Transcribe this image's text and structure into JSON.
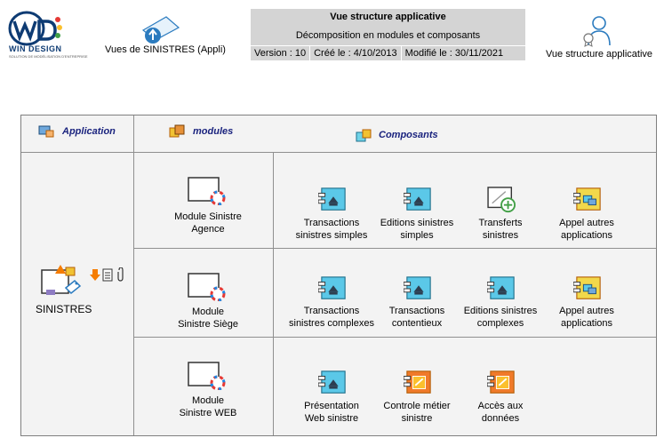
{
  "header": {
    "logo_text": "WIN DESIGN",
    "logo_subtitle": "SOLUTION DE MODÉLISATION D'ENTREPRISE",
    "views_label": "Vues de SINISTRES (Appli)",
    "info": {
      "title": "Vue structure applicative",
      "subtitle": "Décomposition en modules et composants",
      "version": "Version : 10",
      "created": "Créé le : 4/10/2013",
      "modified": "Modifié le : 30/11/2021"
    },
    "view_type_label": "Vue structure applicative"
  },
  "table": {
    "col_application": "Application",
    "col_modules": "modules",
    "col_components": "Composants",
    "application_name": "SINISTRES",
    "rows": [
      {
        "module": [
          "Module Sinistre",
          "Agence"
        ],
        "components": [
          {
            "line1": "Transactions",
            "line2": "sinistres simples",
            "kind": "cyan"
          },
          {
            "line1": "Editions sinistres",
            "line2": "simples",
            "kind": "cyan"
          },
          {
            "line1": "Transferts",
            "line2": "sinistres",
            "kind": "transfer"
          },
          {
            "line1": "Appel autres",
            "line2": "applications",
            "kind": "yellow"
          }
        ]
      },
      {
        "module": [
          "Module",
          "Sinistre Siège"
        ],
        "components": [
          {
            "line1": "Transactions",
            "line2": "sinistres complexes",
            "kind": "cyan"
          },
          {
            "line1": "Transactions",
            "line2": "contentieux",
            "kind": "cyan"
          },
          {
            "line1": "Editions sinistres",
            "line2": "complexes",
            "kind": "cyan"
          },
          {
            "line1": "Appel autres",
            "line2": "applications",
            "kind": "yellow"
          }
        ]
      },
      {
        "module": [
          "Module",
          "Sinistre WEB"
        ],
        "components": [
          {
            "line1": "Présentation",
            "line2": "Web sinistre",
            "kind": "cyan"
          },
          {
            "line1": "Controle métier",
            "line2": "sinistre",
            "kind": "orange"
          },
          {
            "line1": "Accès aux",
            "line2": "données",
            "kind": "orange"
          }
        ]
      }
    ]
  },
  "colors": {
    "header_box": "#d4d4d4",
    "header_text": "#1a237e",
    "cyan_component": "#5bc8e8",
    "yellow_component": "#f2d84b",
    "orange_component": "#f07a2a"
  }
}
